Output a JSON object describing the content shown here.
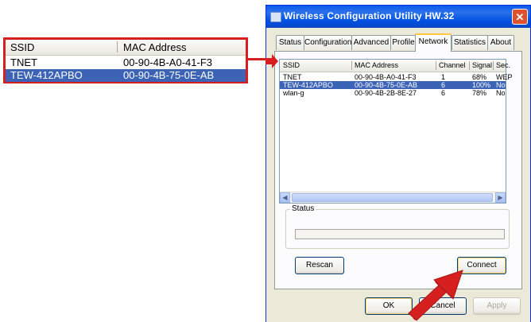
{
  "zoom": {
    "col_ssid": "SSID",
    "col_mac": "MAC Address",
    "rows": [
      {
        "ssid": "TNET",
        "mac": "00-90-4B-A0-41-F3"
      },
      {
        "ssid": "TEW-412APBO",
        "mac": "00-90-4B-75-0E-AB"
      }
    ]
  },
  "dialog": {
    "title": "Wireless Configuration Utility HW.32",
    "close": "✕",
    "tabs": [
      "Status",
      "Configuration",
      "Advanced",
      "Profile",
      "Network",
      "Statistics",
      "About"
    ],
    "active_tab": "Network"
  },
  "network_list": {
    "columns": [
      "SSID",
      "MAC Address",
      "Channel",
      "Signal",
      "Sec."
    ],
    "rows": [
      {
        "ssid": "TNET",
        "mac": "00-90-4B-A0-41-F3",
        "channel": "1",
        "signal": "68%",
        "sec": "WEP"
      },
      {
        "ssid": "TEW-412APBO",
        "mac": "00-90-4B-75-0E-AB",
        "channel": "6",
        "signal": "100%",
        "sec": "No"
      },
      {
        "ssid": "wlan-g",
        "mac": "00-90-4B-2B-8E-27",
        "channel": "6",
        "signal": "78%",
        "sec": "No"
      }
    ],
    "selected_index": 1
  },
  "status_label": "Status",
  "buttons": {
    "rescan": "Rescan",
    "connect": "Connect",
    "ok": "OK",
    "cancel": "Cancel",
    "apply": "Apply"
  },
  "colors": {
    "highlight": "#3d63b6",
    "callout": "#d62020",
    "titlebar": "#0a5ae8"
  }
}
